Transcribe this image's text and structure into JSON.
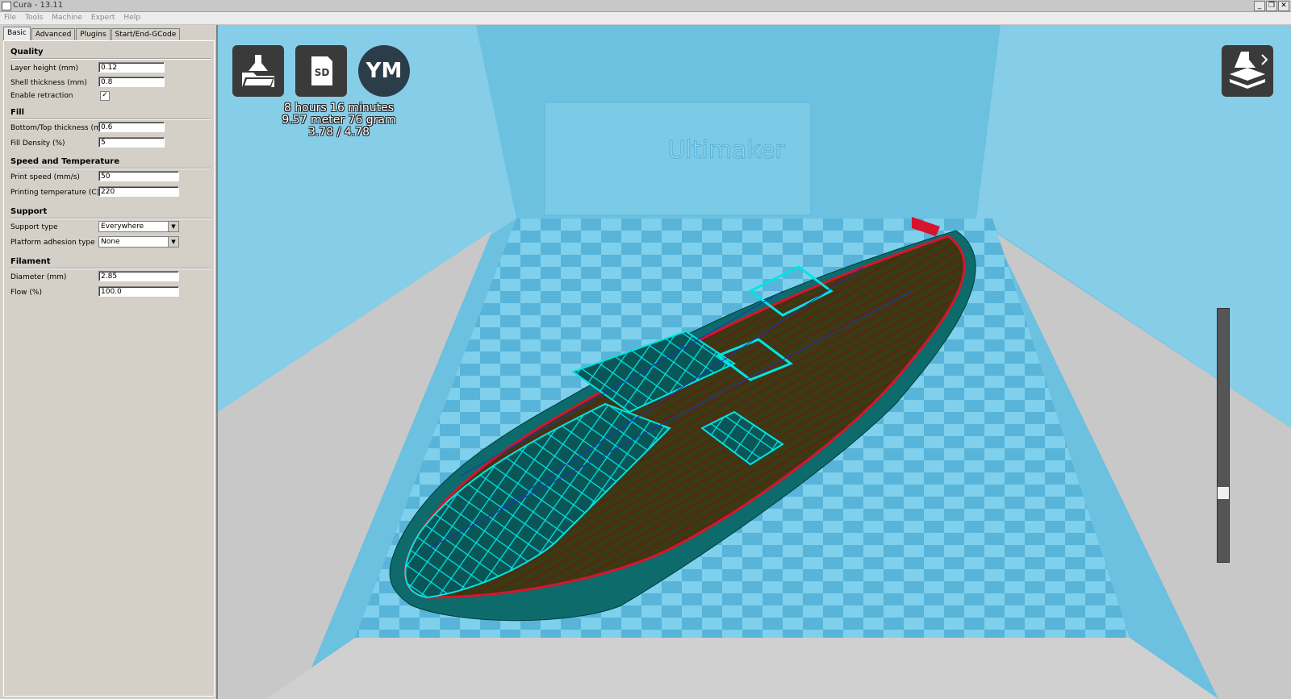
{
  "window": {
    "title": "Cura - 13.11",
    "minimize": "_",
    "restore": "❐",
    "close": "✕"
  },
  "menu": [
    "File",
    "Tools",
    "Machine",
    "Expert",
    "Help"
  ],
  "tabs": [
    "Basic",
    "Advanced",
    "Plugins",
    "Start/End-GCode"
  ],
  "quality": {
    "heading": "Quality",
    "layer_height_label": "Layer height (mm)",
    "layer_height": "0.12",
    "shell_thickness_label": "Shell thickness (mm)",
    "shell_thickness": "0.8",
    "retraction_label": "Enable retraction",
    "retraction_check": "✓"
  },
  "fill": {
    "heading": "Fill",
    "bottom_top_label": "Bottom/Top thickness (mm)",
    "bottom_top": "0.6",
    "density_label": "Fill Density (%)",
    "density": "5"
  },
  "speed": {
    "heading": "Speed and Temperature",
    "print_speed_label": "Print speed (mm/s)",
    "print_speed": "50",
    "temp_label": "Printing temperature (C)",
    "temp": "220"
  },
  "support": {
    "heading": "Support",
    "type_label": "Support type",
    "type": "Everywhere",
    "adhesion_label": "Platform adhesion type",
    "adhesion": "None"
  },
  "filament": {
    "heading": "Filament",
    "diameter_label": "Diameter (mm)",
    "diameter": "2.85",
    "flow_label": "Flow (%)",
    "flow": "100.0"
  },
  "toolbar": {
    "sd_label": "SD",
    "ym_label": "YM"
  },
  "print_info": {
    "time": "8 hours 16 minutes",
    "material": "9.57 meter 76 gram",
    "cost": "3.78 / 4.78"
  },
  "machine_brand": "Ultimaker",
  "layer_slider": {
    "position": 0.26
  },
  "colors": {
    "background": "#6cc0e0",
    "platform_light": "#7fd0ec",
    "platform_dark": "#58b4d8",
    "model": "#0d6b6b",
    "infill": "#00e5e5",
    "outline": "#d8142c"
  }
}
